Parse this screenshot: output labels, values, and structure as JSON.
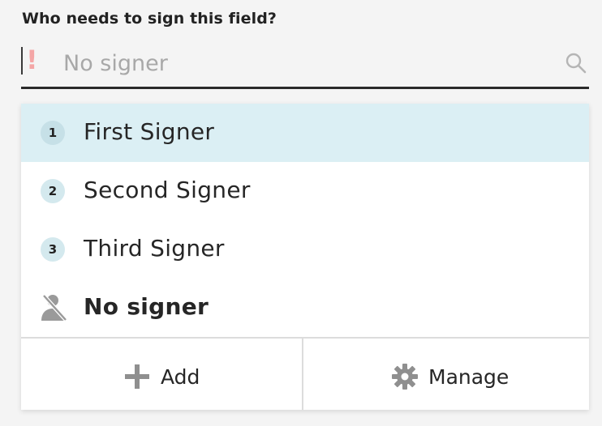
{
  "question": "Who needs to sign this field?",
  "field": {
    "warning_mark": "!",
    "placeholder": "No signer"
  },
  "signers": [
    {
      "number": "1",
      "label": "First Signer",
      "highlighted": true
    },
    {
      "number": "2",
      "label": "Second Signer",
      "highlighted": false
    },
    {
      "number": "3",
      "label": "Third Signer",
      "highlighted": false
    }
  ],
  "no_signer": {
    "label": "No signer",
    "icon": "no-signer-icon"
  },
  "actions": {
    "add_label": "Add",
    "add_icon": "plus-icon",
    "manage_label": "Manage",
    "manage_icon": "gear-icon"
  },
  "colors": {
    "highlight": "#dbeff4",
    "badge": "#d4e9ee",
    "warning": "#f4a6a6",
    "underline": "#2a2a2a"
  }
}
